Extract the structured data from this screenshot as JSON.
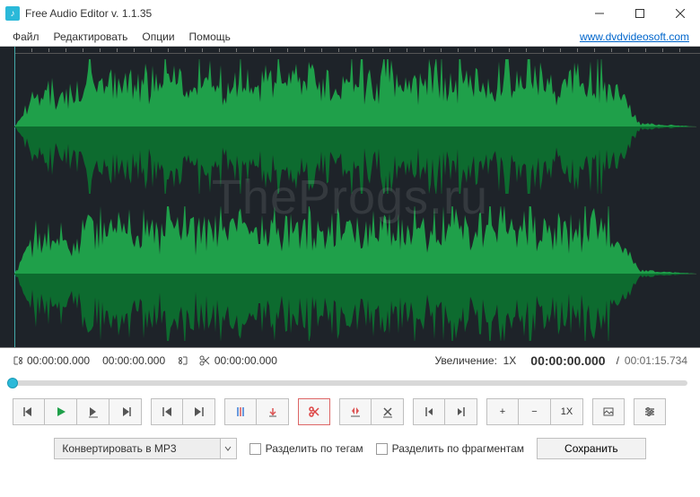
{
  "window": {
    "title": "Free Audio Editor v. 1.1.35",
    "controls": {
      "min": "−",
      "max": "□",
      "close": "×"
    }
  },
  "menu": {
    "file": "Файл",
    "edit": "Редактировать",
    "options": "Опции",
    "help": "Помощь",
    "link": "www.dvdvideosoft.com"
  },
  "watermark": "TheProgs.ru",
  "timebar": {
    "sel_start": "00:00:00.000",
    "sel_end": "00:00:00.000",
    "cut_time": "00:00:00.000",
    "zoom_label": "Увеличение:",
    "zoom_value": "1X",
    "position": "00:00:00.000",
    "total": "00:01:15.734"
  },
  "zoom_button": "1X",
  "bottom": {
    "combo": "Конвертировать в MP3",
    "split_tags": "Разделить по тегам",
    "split_fragments": "Разделить по фрагментам",
    "save": "Сохранить"
  },
  "colors": {
    "waveform": "#1fa04a",
    "bg_dark": "#1e2329",
    "accent": "#2bb9d9"
  }
}
